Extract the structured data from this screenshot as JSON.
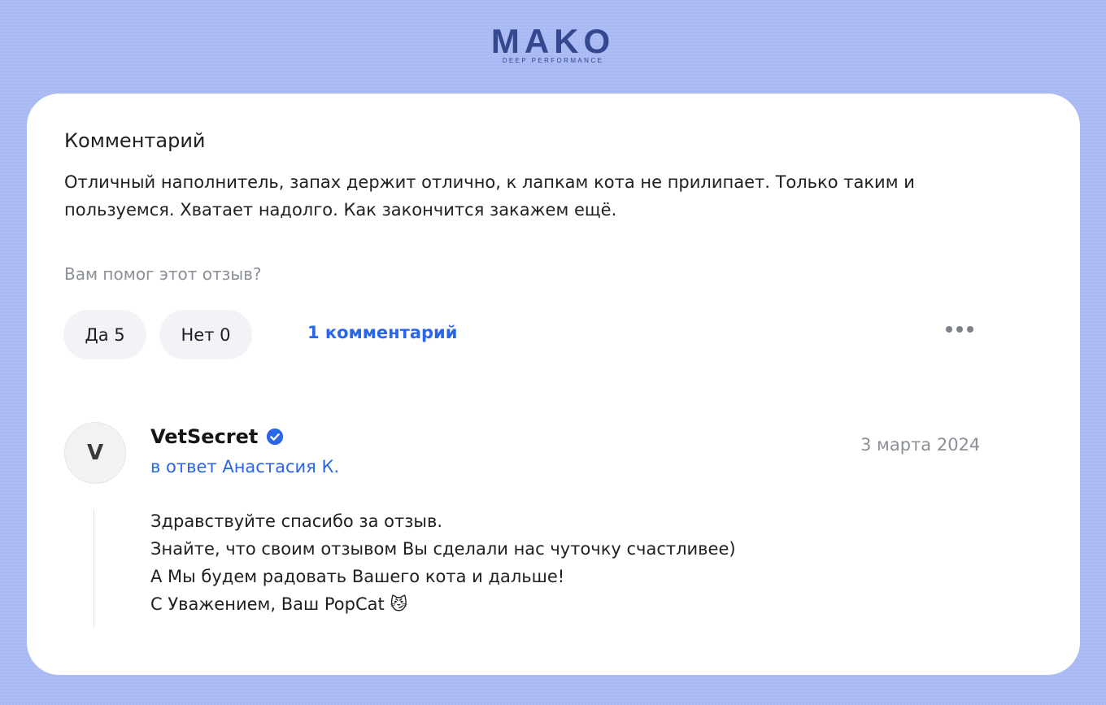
{
  "logo": {
    "word": "MAKO",
    "tagline": "DEEP PERFORMANCE"
  },
  "review": {
    "heading": "Комментарий",
    "text": "Отличный наполнитель, запах держит отлично, к лапкам кота не прилипает. Только таким и пользуемся. Хватает надолго. Как закончится закажем ещё.",
    "helpful_question": "Вам помог этот отзыв?",
    "yes_label": "Да 5",
    "no_label": "Нет 0",
    "comments_link": "1 комментарий"
  },
  "comment": {
    "avatar_letter": "V",
    "author": "VetSecret",
    "reply_to": "в ответ Анастасия К.",
    "date": "3 марта 2024",
    "lines": [
      "Здравствуйте спасибо за отзыв.",
      "Знайте, что своим отзывом Вы сделали нас чуточку счастливее)",
      "А Мы будем радовать Вашего кота и дальше!",
      "С Уважением, Ваш PopCat 😼"
    ]
  },
  "colors": {
    "background": "#a9b9f3",
    "accent": "#2966e8",
    "logo": "#34488f"
  }
}
